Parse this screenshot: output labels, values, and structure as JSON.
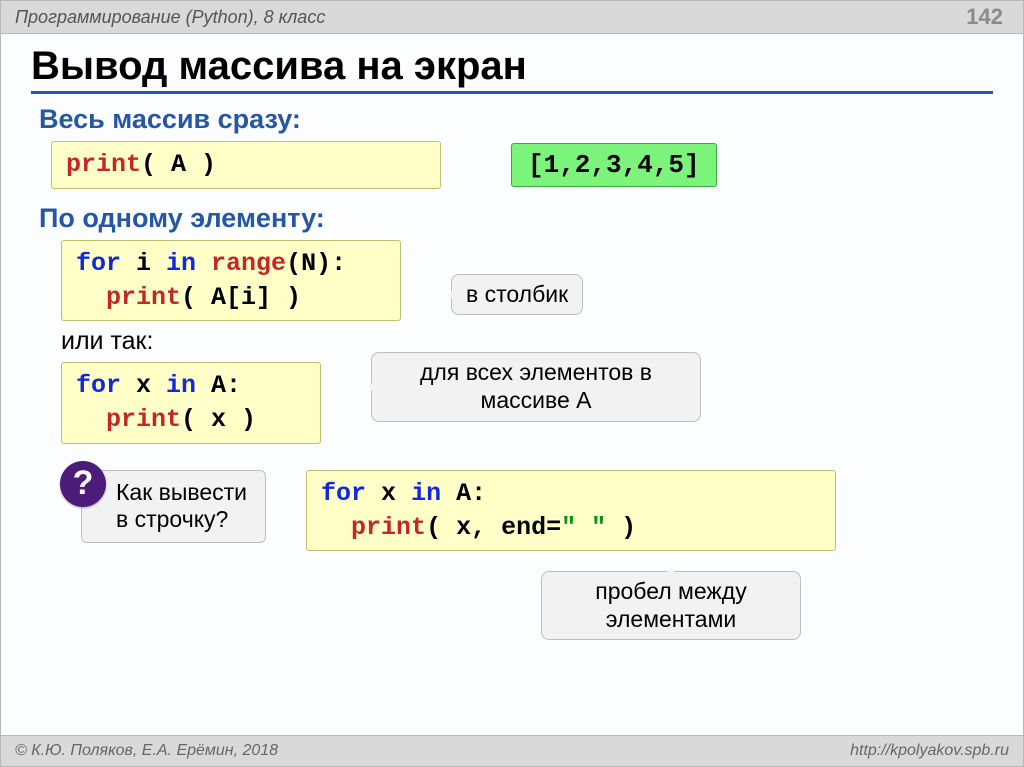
{
  "header": {
    "course": "Программирование (Python), 8 класс",
    "page": "142"
  },
  "title": "Вывод массива на экран",
  "sections": {
    "whole": {
      "heading": "Весь массив сразу:",
      "code": {
        "print": "print",
        "arg": "( A )"
      },
      "output": "[1,2,3,4,5]"
    },
    "per_elem": {
      "heading": "По одному элементу:",
      "code1": {
        "for": "for",
        "i": " i ",
        "in": "in",
        "r": " range",
        "n": "(N):",
        "print": "print",
        "arg": "( A[i] )"
      },
      "callout1": "в столбик",
      "or": "или так:",
      "code2": {
        "for": "for",
        "x": " x ",
        "in": "in",
        "a": " A:",
        "print": "print",
        "arg": "( x )"
      },
      "callout2_l1": "для всех элементов в",
      "callout2_l2": "массиве A"
    },
    "question": {
      "mark": "?",
      "l1": "Как вывести",
      "l2": "в строчку?",
      "code": {
        "for": "for",
        "x": " x ",
        "in": "in",
        "a": " A:",
        "print": "print",
        "arg1": "( x, end=",
        "str": "\" \"",
        "arg2": " )"
      },
      "callout_l1": "пробел между",
      "callout_l2": "элементами"
    }
  },
  "footer": {
    "left": "© К.Ю. Поляков, Е.А. Ерёмин, 2018",
    "right": "http://kpolyakov.spb.ru"
  }
}
